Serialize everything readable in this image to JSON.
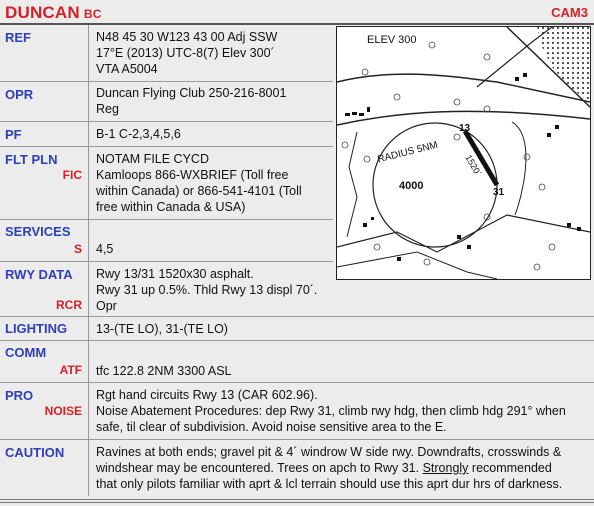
{
  "header": {
    "name": "DUNCAN",
    "province": "BC",
    "code": "CAM3"
  },
  "rows": {
    "ref": {
      "label": "REF",
      "lines": [
        "N48 45 30 W123 43 00   Adj SSW",
        "17°E (2013)   UTC-8(7)   Elev 300´",
        "VTA   A5004"
      ]
    },
    "opr": {
      "label": "OPR",
      "lines": [
        "Duncan Flying Club 250-216-8001",
        "Reg"
      ]
    },
    "pf": {
      "label": "PF",
      "lines": [
        "B-1   C-2,3,4,5,6"
      ]
    },
    "fltpln": {
      "label": "FLT PLN",
      "sub": "FIC",
      "lines": [
        "NOTAM FILE CYCD",
        "Kamloops 866-WXBRIEF (Toll free",
        "within Canada) or 866-541-4101 (Toll",
        "free within Canada & USA)"
      ]
    },
    "services": {
      "label": "SERVICES",
      "sub": "S",
      "lines": [
        "4,5"
      ]
    },
    "rwydata": {
      "label": "RWY DATA",
      "sub": "RCR",
      "lines": [
        "Rwy 13/31    1520x30 asphalt.",
        "Rwy 31 up 0.5%.  Thld Rwy 13 displ 70´.",
        "Opr"
      ]
    },
    "lighting": {
      "label": "LIGHTING",
      "lines": [
        "13-(TE    LO), 31-(TE    LO)"
      ]
    },
    "comm": {
      "label": "COMM",
      "sub": "ATF",
      "lines": [
        "tfc 122.8    2NM 3300 ASL"
      ]
    },
    "pro": {
      "label": "PRO",
      "sub": "NOISE",
      "lines": [
        "Rgt hand circuits Rwy 13 (CAR 602.96).",
        "Noise Abatement Procedures: dep Rwy 31, climb rwy hdg, then climb hdg 291° when",
        "safe, til clear of subdivision. Avoid noise sensitive area to the E."
      ]
    },
    "caution": {
      "label": "CAUTION",
      "lines": [
        "Ravines at both ends; gravel pit & 4´ windrow W side rwy. Downdrafts, crosswinds &",
        "windshear may be encountered. Trees on apch to Rwy 31. ",
        "Strongly",
        " recommended",
        "that only pilots familiar with aprt & lcl terrain should use this aprt dur hrs of darkness."
      ]
    }
  },
  "map": {
    "elev": "ELEV 300",
    "radius": "RADIUS 5NM",
    "circle_alt": "4000",
    "rwy_length": "1520´",
    "rwy_end_a": "13",
    "rwy_end_b": "31"
  }
}
